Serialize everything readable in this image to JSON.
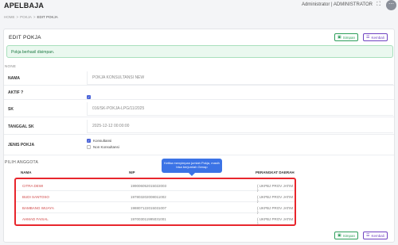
{
  "app": {
    "title": "APELBAJA",
    "user": "Administrator | ADMINISTRATOR"
  },
  "icons": {
    "expand": "expand-icon",
    "menu": "more-icon",
    "save": "save-icon",
    "back": "list-icon",
    "check": "check-icon"
  },
  "breadcrumb": {
    "home": "HOME",
    "sep": ">",
    "parent": "POKJA",
    "current": "EDIT POKJA"
  },
  "page": {
    "title": "EDIT POKJA"
  },
  "buttons": {
    "save": "Simpan",
    "back": "Kembali"
  },
  "alert": {
    "message": "Pokja berhasil disimpan."
  },
  "section_none": "NONE",
  "form": {
    "nama_label": "NAMA",
    "nama_value": "POKJA KONSULTANSI NEW",
    "aktif_label": "AKTIF ?",
    "aktif_checked": true,
    "sk_label": "SK",
    "sk_value": "016/SK-POKJA-LPG/11/2025",
    "tanggal_label": "TANGGAL SK",
    "tanggal_value": "2025-12-12 00:00:00",
    "jenis_label": "JENIS POKJA",
    "jenis_options": [
      {
        "label": "Konsultansi",
        "checked": true
      },
      {
        "label": "Non Konsultansi",
        "checked": false
      }
    ]
  },
  "anggota": {
    "section_title": "PILIH ANGGOTA",
    "tooltip": "Ketika menyimpan jumlah Pokja, masih bisa berjumlah Genap",
    "columns": [
      "NAMA",
      "NIP",
      "PERANGKAT DAERAH"
    ],
    "rows": [
      {
        "nama": "CITRA DEWI",
        "nip": "199006052015022003",
        "daerah": "( UKPBJ PROV JATIM )"
      },
      {
        "nama": "BUDI SANTOSO",
        "nip": "197803202008011002",
        "daerah": "( UKPBJ PROV JATIM )"
      },
      {
        "nama": "BAMBANG WIJAYA",
        "nip": "198807122015031007",
        "daerah": "( UKPBJ PROV JATIM )"
      },
      {
        "nama": "AHMAD FAISAL",
        "nip": "197003011995031001",
        "daerah": "( UKPBJ PROV JATIM )"
      }
    ]
  }
}
